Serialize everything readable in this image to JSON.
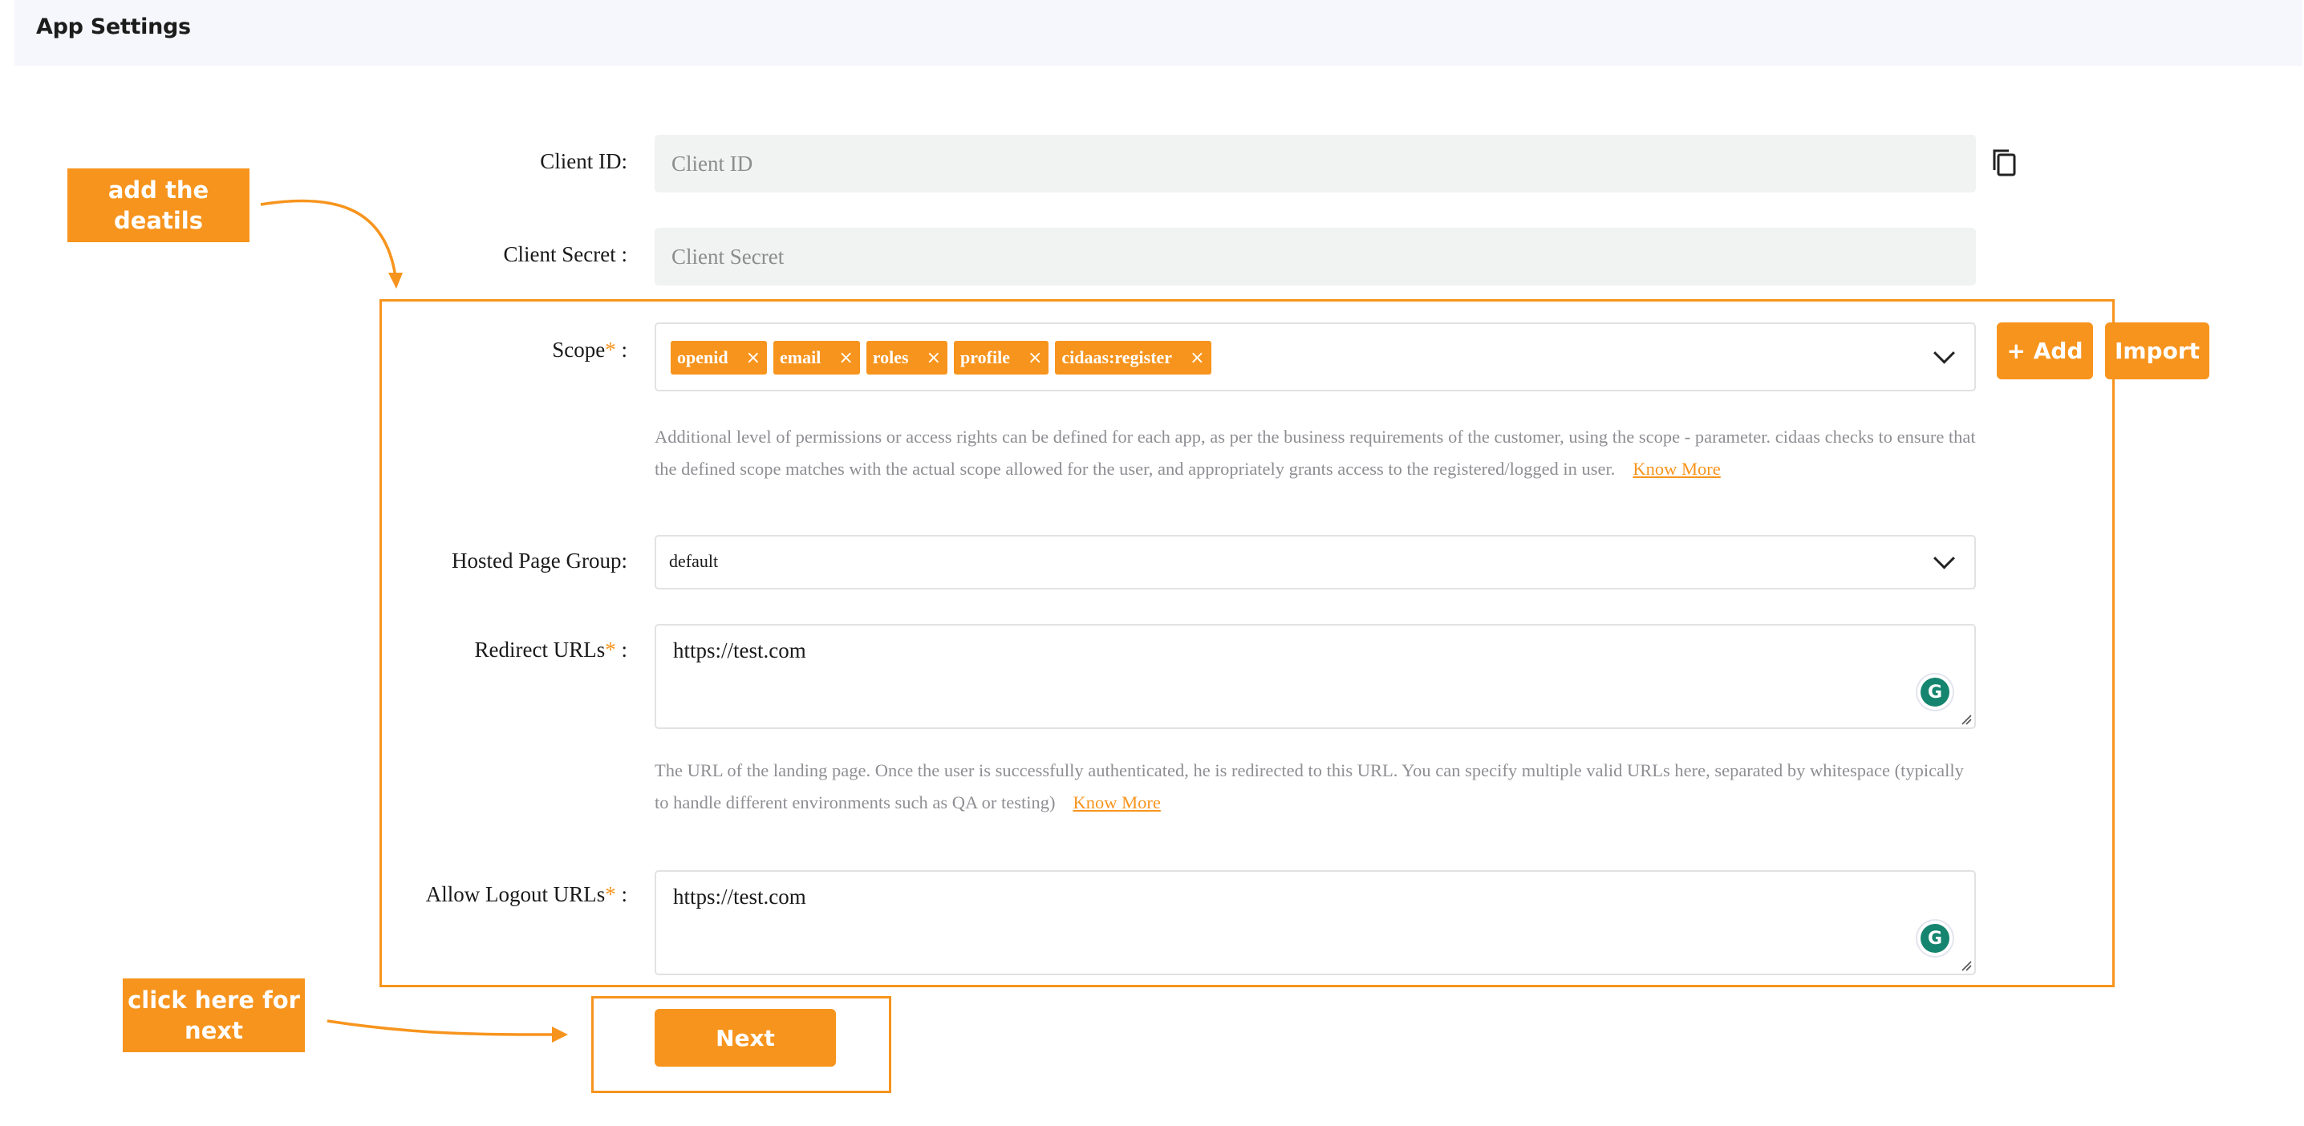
{
  "header": {
    "title": "App Settings"
  },
  "form": {
    "client_id": {
      "label": "Client ID:",
      "placeholder": "Client ID",
      "value": ""
    },
    "client_secret": {
      "label": "Client Secret :",
      "placeholder": "Client Secret",
      "value": ""
    },
    "scope": {
      "label": "Scope",
      "required_mark": "*",
      "label_suffix": " :",
      "tags": [
        {
          "label": "openid",
          "remove_icon": "×"
        },
        {
          "label": "email",
          "remove_icon": "×"
        },
        {
          "label": "roles",
          "remove_icon": "×"
        },
        {
          "label": "profile",
          "remove_icon": "×"
        },
        {
          "label": "cidaas:register",
          "remove_icon": "×"
        }
      ],
      "add_button": "+ Add",
      "import_button": "Import",
      "help_text": "Additional level of permissions or access rights can be defined for each app, as per the business requirements of the customer, using the scope - parameter. cidaas checks to ensure that the defined scope matches with the actual scope allowed for the user, and appropriately grants access to the registered/logged in user.",
      "help_link": "Know More"
    },
    "hosted_page_group": {
      "label": "Hosted Page Group:",
      "selected": "default"
    },
    "redirect_urls": {
      "label": "Redirect URLs",
      "required_mark": "*",
      "label_suffix": " :",
      "value": "https://test.com",
      "help_text": "The URL of the landing page. Once the user is successfully authenticated, he is redirected to this URL. You can specify multiple valid URLs here, separated by whitespace (typically to handle different environments such as QA or testing)",
      "help_link": "Know More"
    },
    "allow_logout_urls": {
      "label": "Allow Logout URLs",
      "required_mark": "*",
      "label_suffix": " :",
      "value": "https://test.com"
    },
    "next_button": "Next"
  },
  "annotations": {
    "callout_details": "add the deatils",
    "callout_next": "click here for next",
    "accent_color": "#f7941d"
  },
  "icons": {
    "copy": "copy-icon",
    "grammarly": "G",
    "chevron": "chevron-down-icon"
  }
}
